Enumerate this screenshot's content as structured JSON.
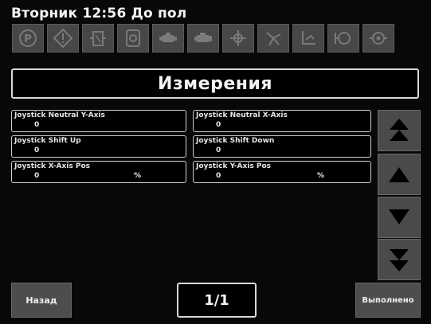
{
  "status": {
    "text": "Вторник 12:56 До пол"
  },
  "toolbar": {
    "icons": [
      "parking-brake-icon",
      "warning-icon",
      "hydraulic-filter-icon",
      "gear-icon",
      "engine-icon",
      "engine-alt-icon",
      "transmission-icon",
      "fan-icon",
      "hydraulic-level-icon",
      "pump-icon",
      "gearbox-icon"
    ]
  },
  "title": "Измерения",
  "measurements": [
    {
      "label": "Joystick Neutral Y-Axis",
      "value": "0",
      "unit": ""
    },
    {
      "label": "Joystick Neutral X-Axis",
      "value": "0",
      "unit": ""
    },
    {
      "label": "Joystick Shift Up",
      "value": "0",
      "unit": ""
    },
    {
      "label": "Joystick Shift Down",
      "value": "0",
      "unit": ""
    },
    {
      "label": "Joystick X-Axis Pos",
      "value": "0",
      "unit": "%"
    },
    {
      "label": "Joystick Y-Axis Pos",
      "value": "0",
      "unit": "%"
    }
  ],
  "pagination": {
    "text": "1/1"
  },
  "buttons": {
    "back": "Назад",
    "done": "Выполнено"
  },
  "colors": {
    "background": "#080808",
    "tile": "#474747",
    "border": "#d8d8d8",
    "text": "#f4f4f4"
  }
}
